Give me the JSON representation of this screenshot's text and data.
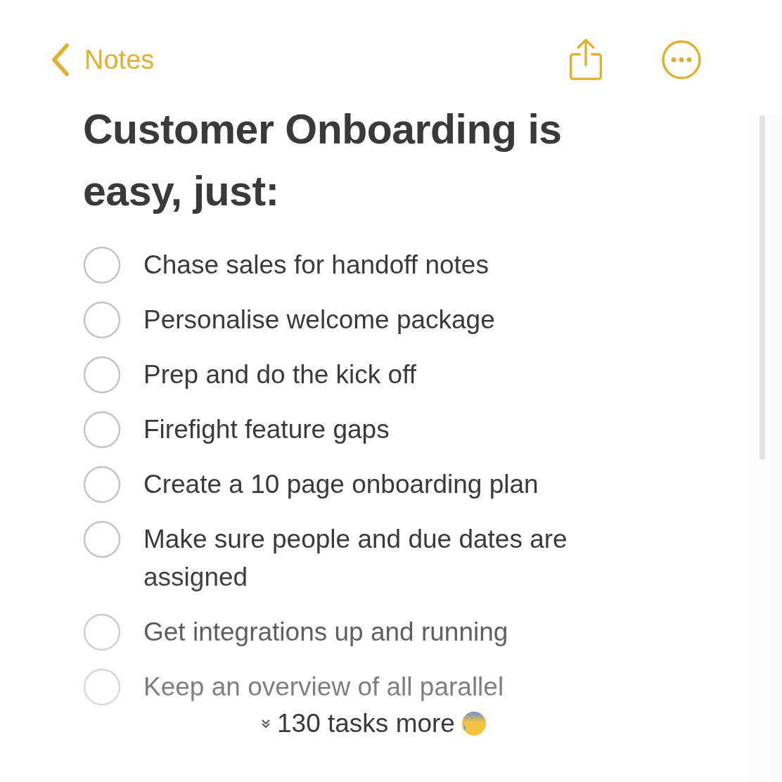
{
  "nav": {
    "back_label": "Notes"
  },
  "note": {
    "title": "Customer Onboarding is easy, just:",
    "tasks": [
      {
        "text": "Chase sales for handoff notes",
        "checked": false
      },
      {
        "text": "Personalise welcome package",
        "checked": false
      },
      {
        "text": "Prep and do the kick off",
        "checked": false
      },
      {
        "text": "Firefight feature gaps",
        "checked": false
      },
      {
        "text": "Create a 10 page onboarding plan",
        "checked": false
      },
      {
        "text": "Make sure people and due dates are assigned",
        "checked": false
      },
      {
        "text": "Get integrations up and running",
        "checked": false
      },
      {
        "text": "Keep an overview of all parallel",
        "checked": false
      }
    ],
    "more_label": "130 tasks more"
  }
}
